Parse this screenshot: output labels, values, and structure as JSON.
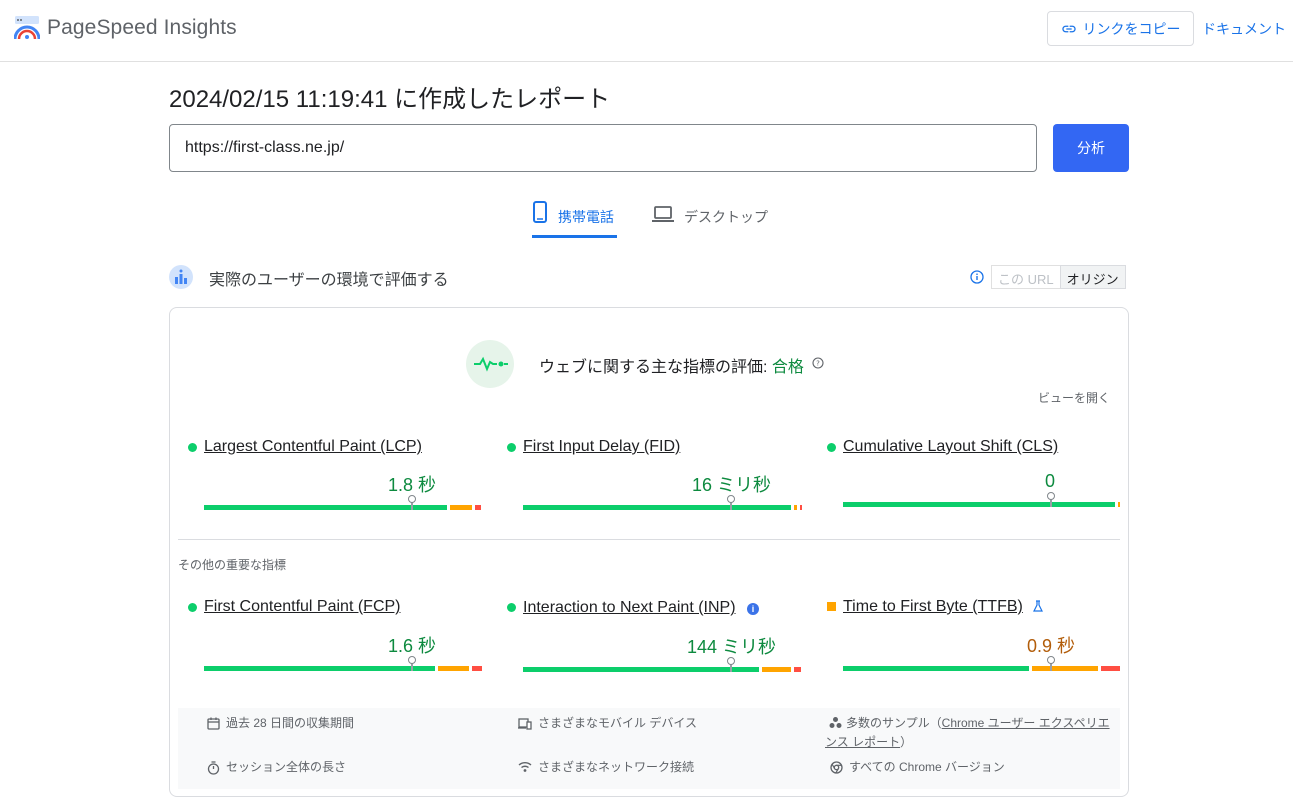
{
  "header": {
    "brand": "PageSpeed Insights",
    "copy_link": "リンクをコピー",
    "docs": "ドキュメント"
  },
  "report": {
    "title": "2024/02/15 11:19:41 に作成したレポート",
    "url": "https://first-class.ne.jp/",
    "analyze": "分析"
  },
  "tabs": [
    {
      "label": "携帯電話",
      "icon": "smartphone-icon",
      "active": true
    },
    {
      "label": "デスクトップ",
      "icon": "laptop-icon",
      "active": false
    }
  ],
  "field": {
    "title": "実際のユーザーの環境で評価する",
    "toggle_url": "この URL",
    "toggle_origin": "オリジン",
    "cwv_label": "ウェブに関する主な指標の評価:",
    "cwv_result": "合格",
    "expand": "ビューを開く",
    "other_label": "その他の重要な指標",
    "core_metrics": [
      {
        "name": "Largest Contentful Paint (LCP)",
        "value": "1.8 秒",
        "status": "good",
        "distribution": [
          0.75,
          0.13,
          0.03
        ]
      },
      {
        "name": "First Input Delay (FID)",
        "value": "16 ミリ秒",
        "status": "good",
        "distribution": [
          0.97,
          0.01,
          0.01
        ]
      },
      {
        "name": "Cumulative Layout Shift (CLS)",
        "value": "0",
        "status": "good",
        "distribution": [
          0.99,
          0.005,
          0.005
        ]
      }
    ],
    "other_metrics": [
      {
        "name": "First Contentful Paint (FCP)",
        "value": "1.6 秒",
        "status": "good",
        "distribution": [
          0.84,
          0.12,
          0.04
        ]
      },
      {
        "name": "Interaction to Next Paint (INP)",
        "value": "144 ミリ秒",
        "status": "good",
        "distribution": [
          0.88,
          0.11,
          0.01
        ]
      },
      {
        "name": "Time to First Byte (TTFB)",
        "value": "0.9 秒",
        "status": "average",
        "distribution": [
          0.68,
          0.25,
          0.07
        ]
      }
    ],
    "footer": {
      "period": "過去 28 日間の収集期間",
      "devices": "さまざまなモバイル デバイス",
      "samples_prefix": "多数のサンプル（",
      "samples_link": "Chrome ユーザー エクスペリエンス レポート",
      "samples_suffix": "）",
      "session": "セッション全体の長さ",
      "network": "さまざまなネットワーク接続",
      "chrome": "すべての Chrome バージョン"
    }
  },
  "colors": {
    "good": "#0cce6b",
    "average": "#ffa400",
    "poor": "#ff4e42",
    "accent": "#1a73e8",
    "button": "#3367f3"
  }
}
